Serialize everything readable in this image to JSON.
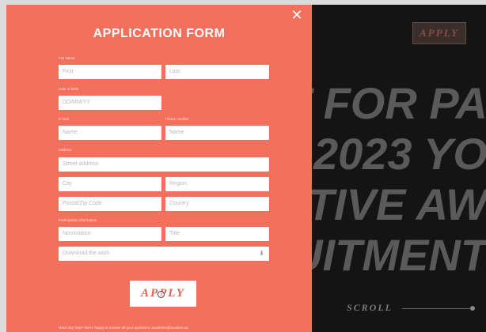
{
  "site": {
    "apply_label": "APPLY",
    "hero_lines": [
      "T FOR PA",
      "2023 YO",
      "TIVE AW",
      "UITMENT"
    ],
    "scroll_label": "SCROLL"
  },
  "modal": {
    "title": "APPLICATION FORM",
    "close_label": "✕",
    "labels": {
      "full_name": "Full Name",
      "dob": "Date of Birth",
      "email": "E-mail",
      "phone": "Phone number",
      "address": "Address",
      "participation": "Participation information"
    },
    "placeholders": {
      "first": "First",
      "last": "Last",
      "dob": "DD/MM/YY",
      "email": "Name",
      "phone": "Name",
      "street": "Street address",
      "city": "City",
      "region": "Region",
      "postal": "Postal/Zip Code",
      "country": "Country",
      "nomination": "Nomination",
      "work_title": "Title",
      "download": "Download the work"
    },
    "download_icon": "⬇",
    "apply_label": "APPLY",
    "footer": "Need any help? We're happy to answer all your questions: academie@academ.ua"
  }
}
